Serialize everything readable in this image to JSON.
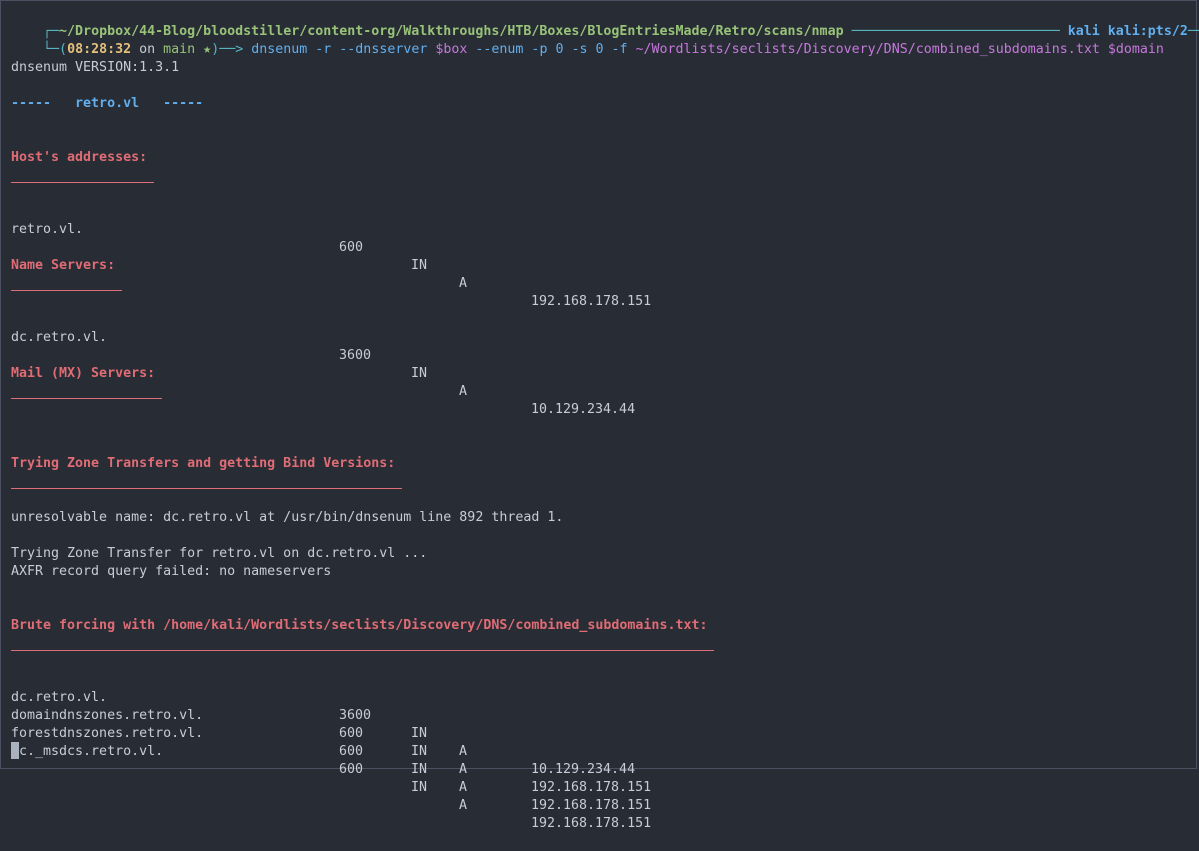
{
  "prompt": {
    "corner_top": "┌─",
    "path": "~/Dropbox/44-Blog/bloodstiller/content-org/Walkthroughs/HTB/Boxes/BlogEntriesMade/Retro/scans/nmap",
    "rule": "──────────────────────────",
    "user_host": "kali kali:pts/2",
    "corner_end": "─┐",
    "corner_bottom": "└─(",
    "time": "08:28:32",
    "on_text": "on",
    "branch": "main ★",
    "arrow": ")──> ",
    "command": "dnsenum -r --dnsserver ",
    "var_box": "$box",
    "command2": " --enum -p 0 -s 0 -f ",
    "wordlist": "~/Wordlists/seclists/Discovery/DNS/combined_subdomains.txt",
    "var_domain": " $domain"
  },
  "output": {
    "version": "dnsenum VERSION:1.3.1",
    "domain_header": "-----   retro.vl   -----",
    "sections": {
      "hosts": "Host's addresses:",
      "ns": "Name Servers:",
      "mx": "Mail (MX) Servers:",
      "zone": "Trying Zone Transfers and getting Bind Versions:",
      "brute": "Brute forcing with /home/kali/Wordlists/seclists/Discovery/DNS/combined_subdomains.txt:"
    },
    "host_records": [
      {
        "name": "retro.vl.",
        "ttl": "600",
        "class": "IN",
        "type": "A",
        "addr": "192.168.178.151"
      }
    ],
    "ns_records": [
      {
        "name": "dc.retro.vl.",
        "ttl": "3600",
        "class": "IN",
        "type": "A",
        "addr": "10.129.234.44"
      }
    ],
    "zone_lines": [
      "unresolvable name: dc.retro.vl at /usr/bin/dnsenum line 892 thread 1.",
      "Trying Zone Transfer for retro.vl on dc.retro.vl ...",
      "AXFR record query failed: no nameservers"
    ],
    "brute_records": [
      {
        "name": "dc.retro.vl.",
        "ttl": "3600",
        "class": "IN",
        "type": "A",
        "addr": "10.129.234.44"
      },
      {
        "name": "domaindnszones.retro.vl.",
        "ttl": "600",
        "class": "IN",
        "type": "A",
        "addr": "192.168.178.151"
      },
      {
        "name": "forestdnszones.retro.vl.",
        "ttl": "600",
        "class": "IN",
        "type": "A",
        "addr": "192.168.178.151"
      },
      {
        "name": "gc._msdcs.retro.vl.",
        "ttl": "600",
        "class": "IN",
        "type": "A",
        "addr": "192.168.178.151"
      }
    ]
  },
  "colors": {
    "background": "#282c34",
    "section_red": "#e06c75",
    "path_green": "#98c379",
    "accent_blue": "#61afef",
    "time_yellow": "#e5c07b",
    "var_purple": "#c678dd"
  }
}
